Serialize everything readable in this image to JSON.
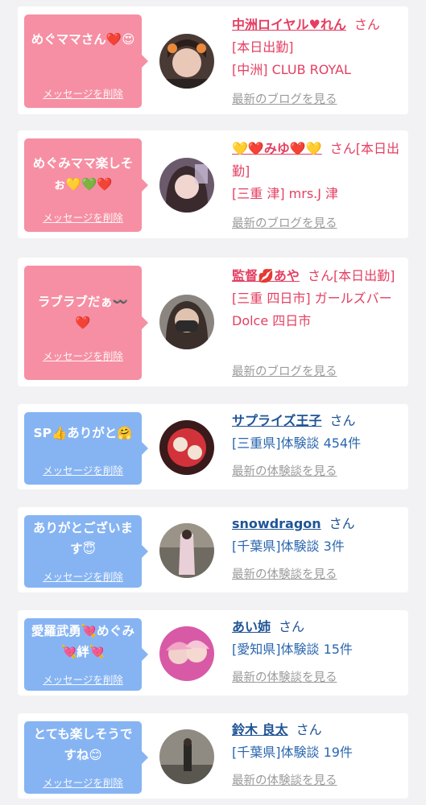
{
  "cards": [
    {
      "message": "めぐママさん❤️😍",
      "delete_label": "メッセージを削除",
      "name": "中洲ロイヤル♥れん",
      "suffix": "さん",
      "line1": "[本日出勤]",
      "line2": "[中洲] CLUB ROYAL",
      "link": "最新のブログを見る"
    },
    {
      "message": "めぐみママ楽しそぉ💛💚❤️",
      "delete_label": "メッセージを削除",
      "name": "💛❤️みゆ❤️💛",
      "suffix": "さん[本日出勤]",
      "line1": "[三重 津] mrs.J 津",
      "link": "最新のブログを見る"
    },
    {
      "message": "ラブラブだぁ〰️❤️",
      "delete_label": "メッセージを削除",
      "name": "監督💋あや",
      "suffix": "さん[本日出勤]",
      "line1": "[三重 四日市] ガールズバー Dolce 四日市",
      "link": "最新のブログを見る"
    },
    {
      "message": "SP👍ありがと🤗",
      "delete_label": "メッセージを削除",
      "name": "サプライズ王子",
      "suffix": "さん",
      "line1": "[三重県]体験談 454件",
      "link": "最新の体験談を見る"
    },
    {
      "message": "ありがとございます😇",
      "delete_label": "メッセージを削除",
      "name": "snowdragon",
      "suffix": "さん",
      "line1": "[千葉県]体験談 3件",
      "link": "最新の体験談を見る"
    },
    {
      "message": "愛羅武勇💘めぐみ💘絆💘",
      "delete_label": "メッセージを削除",
      "name": "あい姉",
      "suffix": "さん",
      "line1": "[愛知県]体験談 15件",
      "link": "最新の体験談を見る"
    },
    {
      "message": "とても楽しそうですね😊",
      "delete_label": "メッセージを削除",
      "name": "鈴木 良太",
      "suffix": "さん",
      "line1": "[千葉県]体験談 19件",
      "link": "最新の体験談を見る"
    }
  ],
  "colors": {
    "pink_bubble": "#f68fa3",
    "blue_bubble": "#86b4f3",
    "pink_text": "#e43f62",
    "blue_text": "#2a66ae",
    "link_gray": "#9b9b9b"
  },
  "icons": [
    "avatar-photo"
  ]
}
